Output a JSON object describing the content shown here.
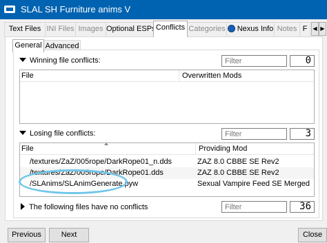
{
  "window": {
    "title": "SLAL SH Furniture anims V"
  },
  "tabs": [
    {
      "label": "Text Files",
      "state": "disabled-look"
    },
    {
      "label": "INI Files",
      "state": "disabled"
    },
    {
      "label": "Images",
      "state": "disabled"
    },
    {
      "label": "Optional ESPs",
      "state": "normal"
    },
    {
      "label": "Conflicts",
      "state": "active"
    },
    {
      "label": "Categories",
      "state": "disabled"
    },
    {
      "label": "Nexus Info",
      "state": "normal",
      "icon": "globe-icon"
    },
    {
      "label": "Notes",
      "state": "disabled"
    },
    {
      "label": "F",
      "state": "normal"
    }
  ],
  "subtabs": [
    "General",
    "Advanced"
  ],
  "winning": {
    "label": "Winning file conflicts:",
    "filter_placeholder": "Filter",
    "count": "0",
    "columns": [
      "File",
      "Overwritten Mods"
    ],
    "rows": []
  },
  "losing": {
    "label": "Losing file conflicts:",
    "filter_placeholder": "Filter",
    "count": "3",
    "columns": [
      "File",
      "Providing Mod"
    ],
    "rows": [
      {
        "file": "/textures/ZaZ/005rope/DarkRope01_n.dds",
        "mod": "ZAZ 8.0 CBBE SE Rev2"
      },
      {
        "file": "/textures/ZaZ/005rope/DarkRope01.dds",
        "mod": "ZAZ 8.0 CBBE SE Rev2"
      },
      {
        "file": "/SLAnims/SLAnimGenerate.pyw",
        "mod": "Sexual Vampire Feed SE Merged"
      }
    ]
  },
  "no_conflicts": {
    "label": "The following files have no conflicts",
    "filter_placeholder": "Filter",
    "count": "36"
  },
  "buttons": {
    "previous": "Previous",
    "next": "Next",
    "close": "Close"
  },
  "colors": {
    "titlebar": "#0063b1",
    "highlight_annotation": "#6ec6ea"
  }
}
